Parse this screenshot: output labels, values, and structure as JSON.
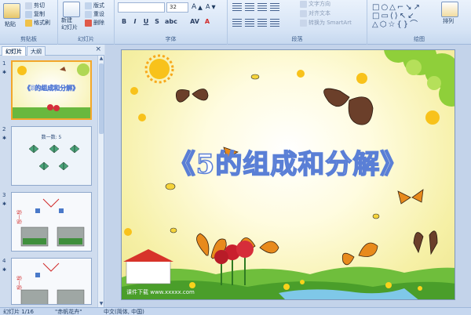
{
  "ribbon": {
    "clipboard": {
      "paste": "粘贴",
      "cut": "剪切",
      "copy": "复制",
      "format_painter": "格式刷",
      "label": "剪贴板"
    },
    "slides": {
      "new_slide": "新建\n幻灯片",
      "layout": "版式",
      "reset": "重设",
      "delete": "删除",
      "label": "幻灯片"
    },
    "font": {
      "font_name": "",
      "font_size": "32",
      "bold": "B",
      "italic": "I",
      "underline": "U",
      "shadow": "S",
      "label": "字体"
    },
    "paragraph": {
      "text_direction": "文字方向",
      "align_text": "对齐文本",
      "smartart": "转换为 SmartArt",
      "label": "段落"
    },
    "drawing": {
      "arrange": "排列",
      "label": "绘图"
    }
  },
  "pane": {
    "tab_slides": "幻灯片",
    "tab_outline": "大纲",
    "close": "×",
    "thumbnails": [
      {
        "number": "1",
        "title": "《5的组成和分解》"
      },
      {
        "number": "2",
        "title": "数一数: 5"
      },
      {
        "number": "3",
        "title": ""
      },
      {
        "number": "4",
        "title": ""
      }
    ]
  },
  "slide": {
    "title": "《5的组成和分解》",
    "watermark": "课件下载 www.xxxxx.com"
  },
  "status": {
    "slide_counter": "幻灯片 1/16",
    "theme": "\"赤帆花卉\"",
    "language": "中文(简体, 中国)"
  },
  "colors": {
    "title_outline": "#5a7fd6",
    "slide_bg": "#f6f0a6",
    "selection": "#f3a72a"
  }
}
